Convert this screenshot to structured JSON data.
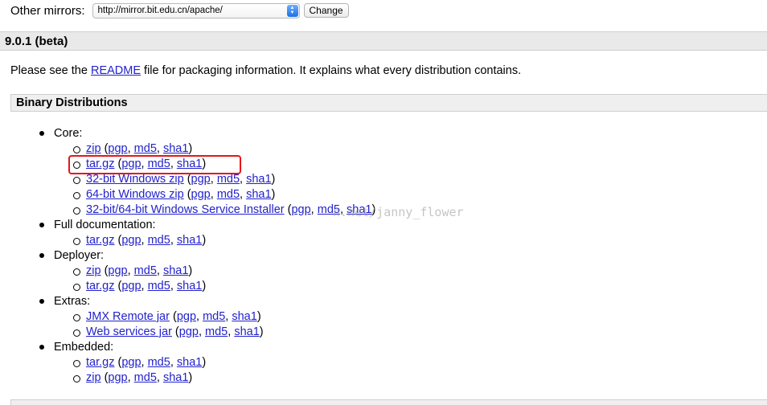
{
  "mirror": {
    "label": "Other mirrors:",
    "selected": "http://mirror.bit.edu.cn/apache/",
    "change_button": "Change"
  },
  "version_title": "9.0.1 (beta)",
  "intro": {
    "before": "Please see the ",
    "link": "README",
    "after": " file for packaging information. It explains what every distribution contains."
  },
  "section_title": "Binary Distributions",
  "categories": [
    {
      "label": "Core:",
      "items": [
        {
          "name": "zip",
          "sigs": [
            "pgp",
            "md5",
            "sha1"
          ]
        },
        {
          "name": "tar.gz",
          "sigs": [
            "pgp",
            "md5",
            "sha1"
          ]
        },
        {
          "name": "32-bit Windows zip",
          "sigs": [
            "pgp",
            "md5",
            "sha1"
          ]
        },
        {
          "name": "64-bit Windows zip",
          "sigs": [
            "pgp",
            "md5",
            "sha1"
          ]
        },
        {
          "name": "32-bit/64-bit Windows Service Installer",
          "sigs": [
            "pgp",
            "md5",
            "sha1"
          ]
        }
      ]
    },
    {
      "label": "Full documentation:",
      "items": [
        {
          "name": "tar.gz",
          "sigs": [
            "pgp",
            "md5",
            "sha1"
          ]
        }
      ]
    },
    {
      "label": "Deployer:",
      "items": [
        {
          "name": "zip",
          "sigs": [
            "pgp",
            "md5",
            "sha1"
          ]
        },
        {
          "name": "tar.gz",
          "sigs": [
            "pgp",
            "md5",
            "sha1"
          ]
        }
      ]
    },
    {
      "label": "Extras:",
      "items": [
        {
          "name": "JMX Remote jar",
          "sigs": [
            "pgp",
            "md5",
            "sha1"
          ]
        },
        {
          "name": "Web services jar",
          "sigs": [
            "pgp",
            "md5",
            "sha1"
          ]
        }
      ]
    },
    {
      "label": "Embedded:",
      "items": [
        {
          "name": "tar.gz",
          "sigs": [
            "pgp",
            "md5",
            "sha1"
          ]
        },
        {
          "name": "zip",
          "sigs": [
            "pgp",
            "md5",
            "sha1"
          ]
        }
      ]
    }
  ],
  "watermark": "n.net/janny_flower",
  "colors": {
    "link": "#2222cc",
    "highlight": "#e8151b",
    "header_bg": "#e9e9e9"
  }
}
